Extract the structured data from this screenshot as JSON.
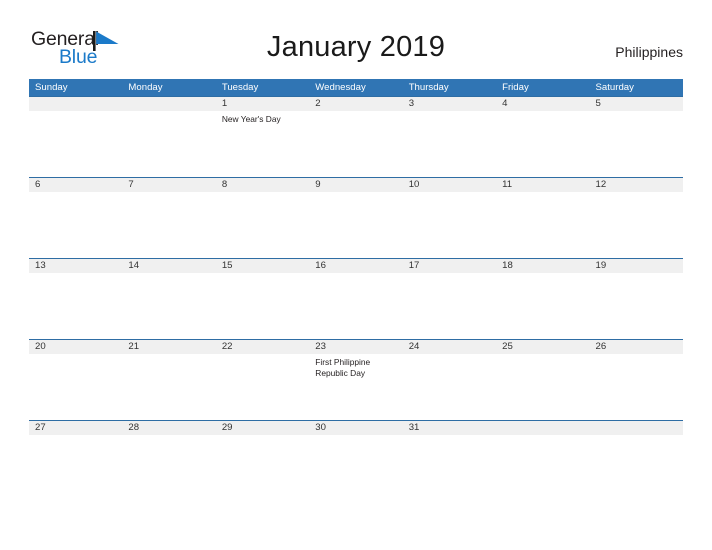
{
  "brand": {
    "name_part1": "General",
    "name_part2": "Blue",
    "flag_icon": "triangle-flag-icon",
    "accent_color": "#1b7ac9"
  },
  "header": {
    "title": "January 2019",
    "month": "January",
    "year": "2019",
    "country": "Philippines"
  },
  "colors": {
    "header_band": "#3075b4",
    "row_band": "#f0f0f0",
    "row_rule": "#2e6da4",
    "text": "#231f20",
    "logo_blue": "#1b7ac9"
  },
  "calendar": {
    "weekdays": [
      "Sunday",
      "Monday",
      "Tuesday",
      "Wednesday",
      "Thursday",
      "Friday",
      "Saturday"
    ],
    "weeks": [
      [
        {
          "day": "",
          "event": ""
        },
        {
          "day": "",
          "event": ""
        },
        {
          "day": "1",
          "event": "New Year's Day"
        },
        {
          "day": "2",
          "event": ""
        },
        {
          "day": "3",
          "event": ""
        },
        {
          "day": "4",
          "event": ""
        },
        {
          "day": "5",
          "event": ""
        }
      ],
      [
        {
          "day": "6",
          "event": ""
        },
        {
          "day": "7",
          "event": ""
        },
        {
          "day": "8",
          "event": ""
        },
        {
          "day": "9",
          "event": ""
        },
        {
          "day": "10",
          "event": ""
        },
        {
          "day": "11",
          "event": ""
        },
        {
          "day": "12",
          "event": ""
        }
      ],
      [
        {
          "day": "13",
          "event": ""
        },
        {
          "day": "14",
          "event": ""
        },
        {
          "day": "15",
          "event": ""
        },
        {
          "day": "16",
          "event": ""
        },
        {
          "day": "17",
          "event": ""
        },
        {
          "day": "18",
          "event": ""
        },
        {
          "day": "19",
          "event": ""
        }
      ],
      [
        {
          "day": "20",
          "event": ""
        },
        {
          "day": "21",
          "event": ""
        },
        {
          "day": "22",
          "event": ""
        },
        {
          "day": "23",
          "event": "First Philippine Republic Day"
        },
        {
          "day": "24",
          "event": ""
        },
        {
          "day": "25",
          "event": ""
        },
        {
          "day": "26",
          "event": ""
        }
      ],
      [
        {
          "day": "27",
          "event": ""
        },
        {
          "day": "28",
          "event": ""
        },
        {
          "day": "29",
          "event": ""
        },
        {
          "day": "30",
          "event": ""
        },
        {
          "day": "31",
          "event": ""
        },
        {
          "day": "",
          "event": ""
        },
        {
          "day": "",
          "event": ""
        }
      ]
    ]
  }
}
